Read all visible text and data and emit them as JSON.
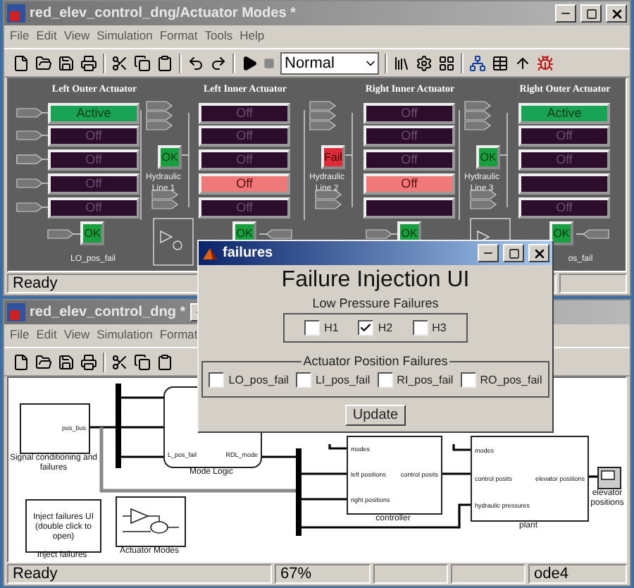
{
  "model_window": {
    "title": "red_elev_control_dng/Actuator Modes *",
    "menu": [
      "File",
      "Edit",
      "View",
      "Simulation",
      "Format",
      "Tools",
      "Help"
    ],
    "sim_mode": "Normal",
    "actuators": [
      {
        "title": "Left Outer Actuator",
        "displays": [
          {
            "text": "Active",
            "active": true,
            "alarm": false
          },
          {
            "text": "Off",
            "active": false,
            "alarm": false
          },
          {
            "text": "Off",
            "active": false,
            "alarm": false
          },
          {
            "text": "Off",
            "active": false,
            "alarm": false
          },
          {
            "text": "Off",
            "active": false,
            "alarm": false
          }
        ],
        "position_indicator": {
          "text": "OK",
          "failed": false
        },
        "position_label": "LO_pos_fail"
      },
      {
        "title": "Left Inner Actuator",
        "displays": [
          {
            "text": "Off",
            "active": false,
            "alarm": false
          },
          {
            "text": "Off",
            "active": false,
            "alarm": false
          },
          {
            "text": "Off",
            "active": false,
            "alarm": false
          },
          {
            "text": "Off",
            "active": false,
            "alarm": true
          },
          {
            "text": "Off",
            "active": false,
            "alarm": false
          }
        ],
        "position_indicator": {
          "text": "OK",
          "failed": false
        }
      },
      {
        "title": "Right Inner Actuator",
        "displays": [
          {
            "text": "Off",
            "active": false,
            "alarm": false
          },
          {
            "text": "Off",
            "active": false,
            "alarm": false
          },
          {
            "text": "Off",
            "active": false,
            "alarm": false
          },
          {
            "text": "Off",
            "active": false,
            "alarm": true
          },
          {
            "active": false,
            "alarm": false
          }
        ],
        "position_indicator": {
          "text": "OK",
          "failed": false
        }
      },
      {
        "title": "Right Outer Actuator",
        "displays": [
          {
            "text": "Active",
            "active": true,
            "alarm": false
          },
          {
            "text": "Off",
            "active": false,
            "alarm": false
          },
          {
            "text": "Off",
            "active": false,
            "alarm": false
          },
          {
            "active": false,
            "alarm": false
          },
          {
            "text": "Off",
            "active": false,
            "alarm": false
          }
        ],
        "position_indicator": {
          "text": "OK",
          "failed": false
        },
        "position_label": "os_fail"
      }
    ],
    "hydraulic_lines": [
      {
        "label": "Hydraulic Line 1",
        "text": "OK",
        "failed": false
      },
      {
        "label": "Hydraulic Line 2",
        "text": "Fail",
        "failed": true
      },
      {
        "label": "Hydraulic Line 3",
        "text": "OK",
        "failed": false
      }
    ],
    "status": "Ready"
  },
  "diagram_window": {
    "title": "red_elev_control_dng *",
    "menu": [
      "File",
      "Edit",
      "View",
      "Simulation",
      "Format"
    ],
    "blocks": [
      {
        "kind": "subsystem",
        "name": "Signal conditioning and failures",
        "outputs": [
          "pos_bus"
        ]
      },
      {
        "kind": "chart",
        "name": "Mode Logic",
        "inputs": [
          "L_pos_fail"
        ],
        "outputs": [
          "RDL_mode"
        ]
      },
      {
        "kind": "mask",
        "name": "Inject failures",
        "body": "Inject failures UI (double click to open)"
      },
      {
        "kind": "drawing",
        "name": "Actuator Modes"
      },
      {
        "kind": "subsystem",
        "name": "controller",
        "inputs": [
          "modes",
          "left positions",
          "right positions"
        ],
        "outputs": [
          "control posits"
        ]
      },
      {
        "kind": "subsystem",
        "name": "plant",
        "inputs": [
          "modes",
          "control posits",
          "hydraulic pressures"
        ],
        "outputs": [
          "elevator positions"
        ]
      },
      {
        "kind": "scope",
        "name": "elevator positions"
      }
    ],
    "status": {
      "text": "Ready",
      "zoom": "67%",
      "solver": "ode4"
    }
  },
  "dialog": {
    "title": "failures",
    "heading": "Failure Injection UI",
    "groups": [
      {
        "kind": "plain",
        "title": "Low Pressure Failures",
        "options": [
          {
            "label": "H1",
            "checked": false
          },
          {
            "label": "H2",
            "checked": true
          },
          {
            "label": "H3",
            "checked": false
          }
        ]
      },
      {
        "kind": "legend",
        "title": "Actuator Position Failures",
        "options": [
          {
            "label": "LO_pos_fail",
            "checked": false
          },
          {
            "label": "LI_pos_fail",
            "checked": false
          },
          {
            "label": "RI_pos_fail",
            "checked": false
          },
          {
            "label": "RO_pos_fail",
            "checked": false
          }
        ]
      }
    ],
    "button": "Update"
  }
}
